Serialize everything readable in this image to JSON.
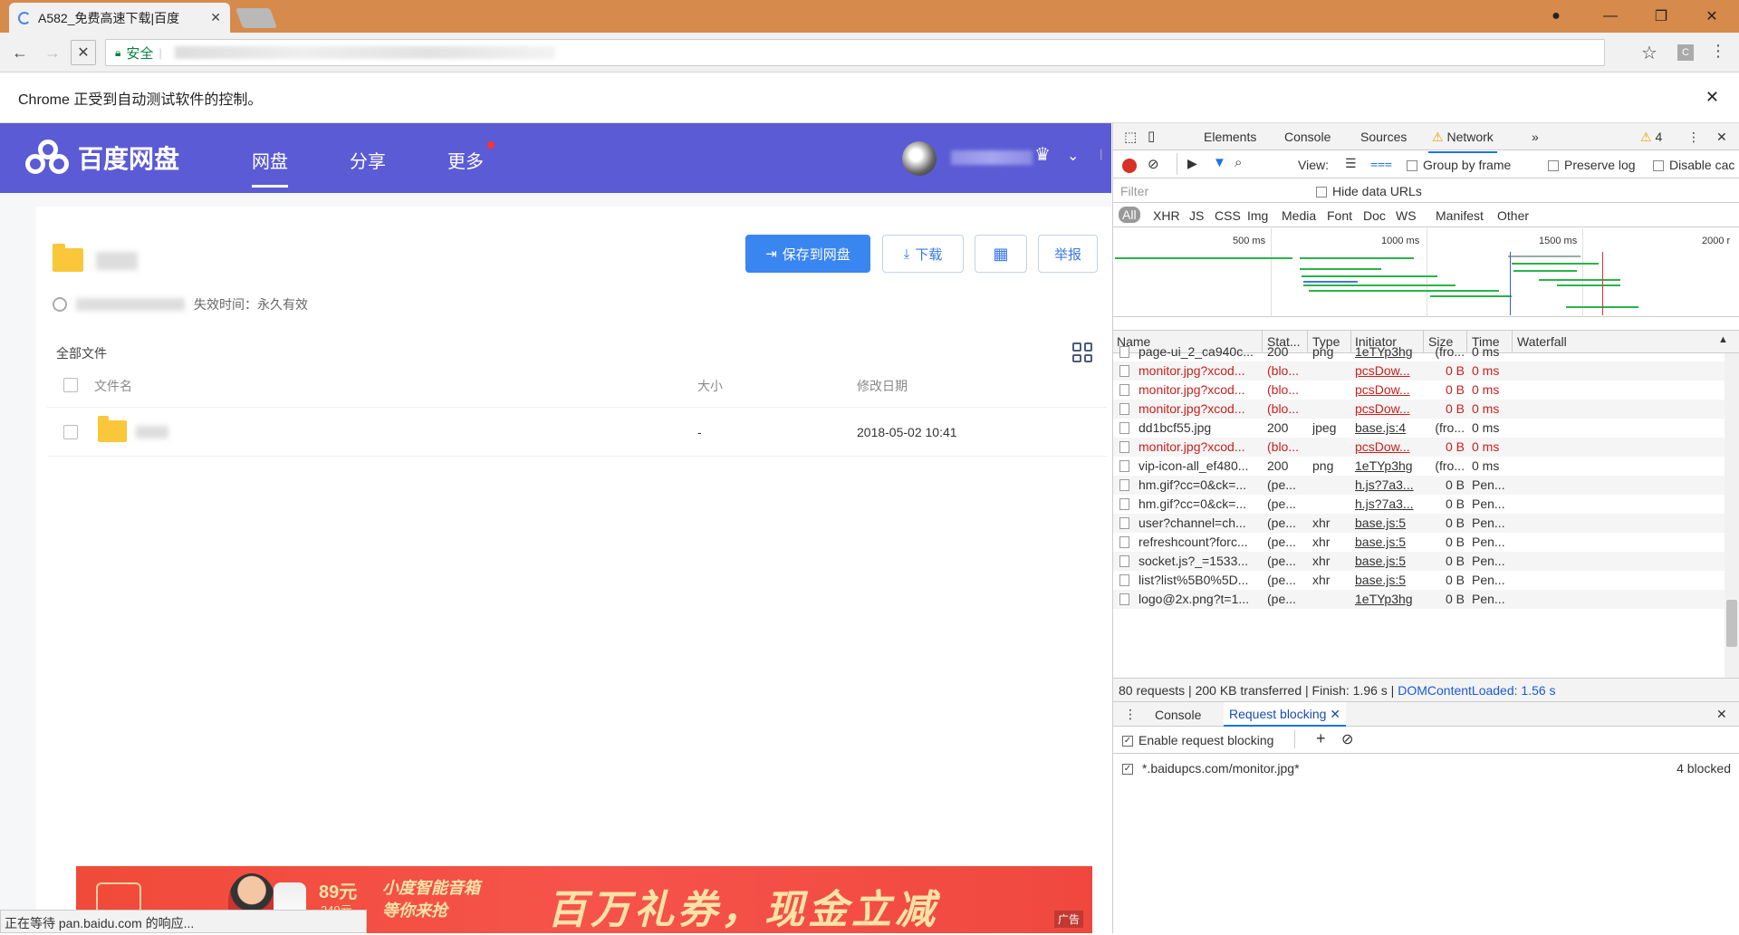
{
  "browser": {
    "tab_title": "A582_免费高速下载|百度",
    "security_label": "安全",
    "infobar_text": "Chrome 正受到自动测试软件的控制。",
    "status_text": "正在等待 pan.baidu.com 的响应...",
    "ext_label": "C"
  },
  "baidu": {
    "logo_text": "百度网盘",
    "nav": [
      "网盘",
      "分享",
      "更多"
    ],
    "buttons": {
      "save": "保存到网盘",
      "download": "下载",
      "report": "举报"
    },
    "expire_text": "失效时间：永久有效",
    "all_files": "全部文件",
    "columns": {
      "name": "文件名",
      "size": "大小",
      "date": "修改日期"
    },
    "file": {
      "size": "-",
      "date": "2018-05-02 10:41"
    },
    "ad": {
      "price": "89元",
      "old_price": "249元",
      "slogan_top": "小度智能音箱",
      "slogan_bottom": "等你来抢",
      "headline": "百万礼券，现金立减",
      "tag": "广告"
    }
  },
  "devtools": {
    "tabs": [
      "Elements",
      "Console",
      "Sources",
      "Network"
    ],
    "active_tab": "Network",
    "warning_count": "4",
    "toolbar": {
      "view": "View:",
      "group": "Group by frame",
      "preserve": "Preserve log",
      "disable": "Disable cac"
    },
    "filter_placeholder": "Filter",
    "hide_data": "Hide data URLs",
    "types": [
      "All",
      "XHR",
      "JS",
      "CSS",
      "Img",
      "Media",
      "Font",
      "Doc",
      "WS",
      "Manifest",
      "Other"
    ],
    "overview_ticks": [
      "500 ms",
      "1000 ms",
      "1500 ms",
      "2000 r"
    ],
    "columns": [
      "Name",
      "Stat...",
      "Type",
      "Initiator",
      "Size",
      "Time",
      "Waterfall"
    ],
    "requests": [
      {
        "name": "page-ui_2_ca940c...",
        "status": "200",
        "type": "png",
        "initiator": "1eTYp3hg",
        "size": "(fro...",
        "time": "0 ms",
        "blocked": false
      },
      {
        "name": "monitor.jpg?xcod...",
        "status": "(blo...",
        "type": "",
        "initiator": "pcsDow...",
        "size": "0 B",
        "time": "0 ms",
        "blocked": true
      },
      {
        "name": "monitor.jpg?xcod...",
        "status": "(blo...",
        "type": "",
        "initiator": "pcsDow...",
        "size": "0 B",
        "time": "0 ms",
        "blocked": true
      },
      {
        "name": "monitor.jpg?xcod...",
        "status": "(blo...",
        "type": "",
        "initiator": "pcsDow...",
        "size": "0 B",
        "time": "0 ms",
        "blocked": true
      },
      {
        "name": "dd1bcf55.jpg",
        "status": "200",
        "type": "jpeg",
        "initiator": "base.js:4",
        "size": "(fro...",
        "time": "0 ms",
        "blocked": false
      },
      {
        "name": "monitor.jpg?xcod...",
        "status": "(blo...",
        "type": "",
        "initiator": "pcsDow...",
        "size": "0 B",
        "time": "0 ms",
        "blocked": true
      },
      {
        "name": "vip-icon-all_ef480...",
        "status": "200",
        "type": "png",
        "initiator": "1eTYp3hg",
        "size": "(fro...",
        "time": "0 ms",
        "blocked": false
      },
      {
        "name": "hm.gif?cc=0&ck=...",
        "status": "(pe...",
        "type": "",
        "initiator": "h.js?7a3...",
        "size": "0 B",
        "time": "Pen...",
        "blocked": false
      },
      {
        "name": "hm.gif?cc=0&ck=...",
        "status": "(pe...",
        "type": "",
        "initiator": "h.js?7a3...",
        "size": "0 B",
        "time": "Pen...",
        "blocked": false
      },
      {
        "name": "user?channel=ch...",
        "status": "(pe...",
        "type": "xhr",
        "initiator": "base.js:5",
        "size": "0 B",
        "time": "Pen...",
        "blocked": false
      },
      {
        "name": "refreshcount?forc...",
        "status": "(pe...",
        "type": "xhr",
        "initiator": "base.js:5",
        "size": "0 B",
        "time": "Pen...",
        "blocked": false
      },
      {
        "name": "socket.js?_=1533...",
        "status": "(pe...",
        "type": "xhr",
        "initiator": "base.js:5",
        "size": "0 B",
        "time": "Pen...",
        "blocked": false
      },
      {
        "name": "list?list%5B0%5D...",
        "status": "(pe...",
        "type": "xhr",
        "initiator": "base.js:5",
        "size": "0 B",
        "time": "Pen...",
        "blocked": false
      },
      {
        "name": "logo@2x.png?t=1...",
        "status": "(pe...",
        "type": "",
        "initiator": "1eTYp3hg",
        "size": "0 B",
        "time": "Pen...",
        "blocked": false
      }
    ],
    "summary": {
      "requests": "80 requests",
      "transferred": "200 KB transferred",
      "finish": "Finish: 1.96 s",
      "dcl": "DOMContentLoaded: 1.56 s"
    },
    "drawer_tabs": [
      "Console",
      "Request blocking"
    ],
    "enable_blocking": "Enable request blocking",
    "pattern": "*.baidupcs.com/monitor.jpg*",
    "blocked_count": "4 blocked"
  }
}
